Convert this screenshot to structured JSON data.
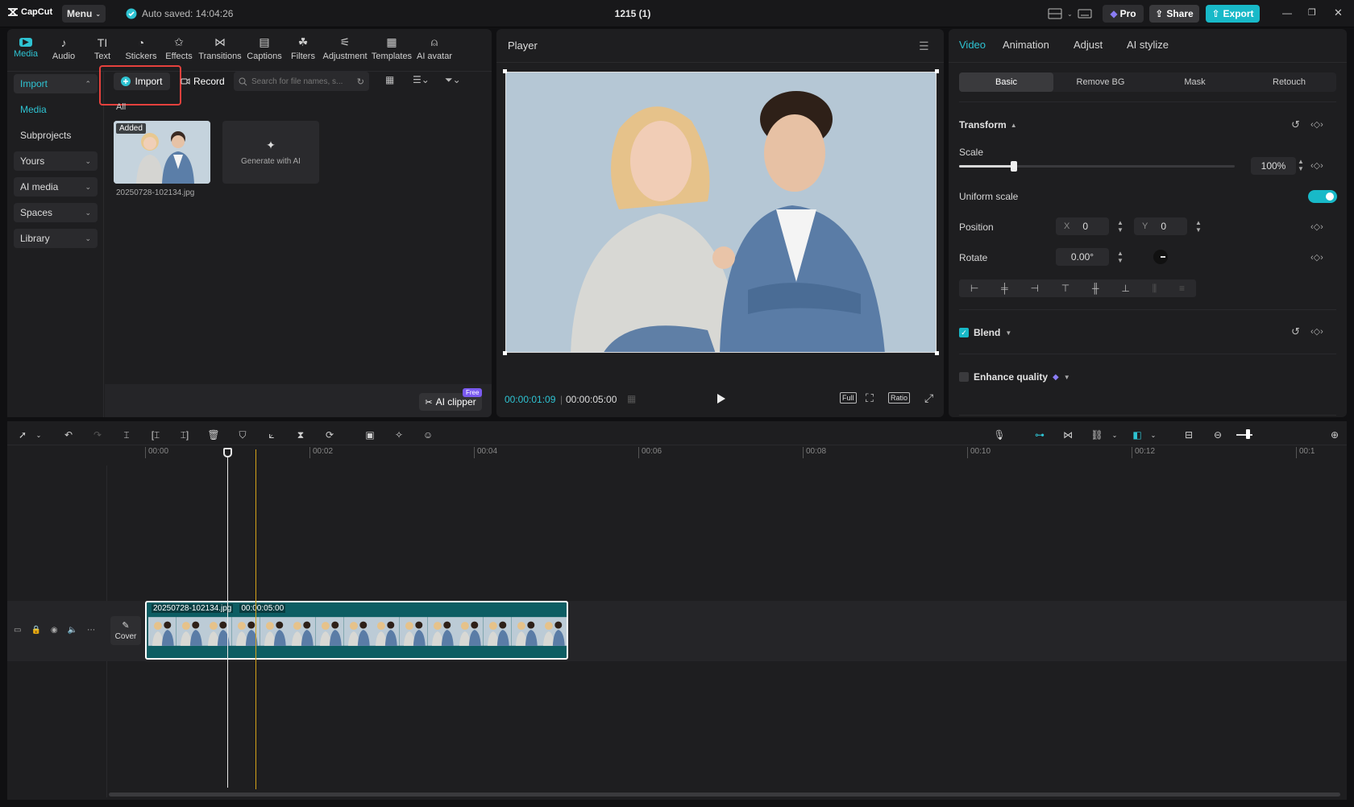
{
  "app": {
    "logo": "CapCut",
    "menu_label": "Menu",
    "autosave_text": "Auto saved: 14:04:26",
    "project_title": "1215 (1)",
    "pro_label": "Pro",
    "share_label": "Share",
    "export_label": "Export"
  },
  "media_tools": [
    {
      "label": "Media",
      "icon": "media-icon"
    },
    {
      "label": "Audio",
      "icon": "audio-icon"
    },
    {
      "label": "Text",
      "icon": "text-icon"
    },
    {
      "label": "Stickers",
      "icon": "stickers-icon"
    },
    {
      "label": "Effects",
      "icon": "effects-icon"
    },
    {
      "label": "Transitions",
      "icon": "transitions-icon"
    },
    {
      "label": "Captions",
      "icon": "captions-icon"
    },
    {
      "label": "Filters",
      "icon": "filters-icon"
    },
    {
      "label": "Adjustment",
      "icon": "adjustment-icon"
    },
    {
      "label": "Templates",
      "icon": "templates-icon"
    },
    {
      "label": "AI avatar",
      "icon": "ai-avatar-icon"
    }
  ],
  "sidebar": {
    "import": "Import",
    "media": "Media",
    "subprojects": "Subprojects",
    "yours": "Yours",
    "ai_media": "AI media",
    "spaces": "Spaces",
    "library": "Library"
  },
  "media_panel": {
    "import_button": "Import",
    "record_button": "Record",
    "search_placeholder": "Search for file names, s...",
    "filter_all": "All",
    "thumb_badge": "Added",
    "thumb_name": "20250728-102134.jpg",
    "generate_ai": "Generate with AI",
    "ai_clipper": "AI clipper",
    "free_badge": "Free"
  },
  "player": {
    "title": "Player",
    "current_time": "00:00:01:09",
    "total_time": "00:00:05:00",
    "full_label": "Full",
    "ratio_label": "Ratio"
  },
  "inspector": {
    "tabs": [
      "Video",
      "Animation",
      "Adjust",
      "AI stylize"
    ],
    "subtabs": [
      "Basic",
      "Remove BG",
      "Mask",
      "Retouch"
    ],
    "transform": "Transform",
    "scale_label": "Scale",
    "scale_value": "100%",
    "scale_fraction": 0.2,
    "uniform_scale": "Uniform scale",
    "position_label": "Position",
    "pos_x_label": "X",
    "pos_x": "0",
    "pos_y_label": "Y",
    "pos_y": "0",
    "rotate_label": "Rotate",
    "rotate_value": "0.00°",
    "blend": "Blend",
    "enhance_quality": "Enhance quality"
  },
  "timeline": {
    "ruler": [
      "00:00",
      "00:02",
      "00:04",
      "00:06",
      "00:08",
      "00:10",
      "00:12",
      "00:1"
    ],
    "clip_name": "20250728-102134.jpg",
    "clip_duration": "00:00:05:00",
    "cover_label": "Cover"
  },
  "colors": {
    "accent": "#2ec3d2",
    "import_highlight": "#e5413d",
    "clip_bg": "#0d5d63",
    "playhead": "#e8e8e8",
    "marker": "#d4a21a"
  }
}
